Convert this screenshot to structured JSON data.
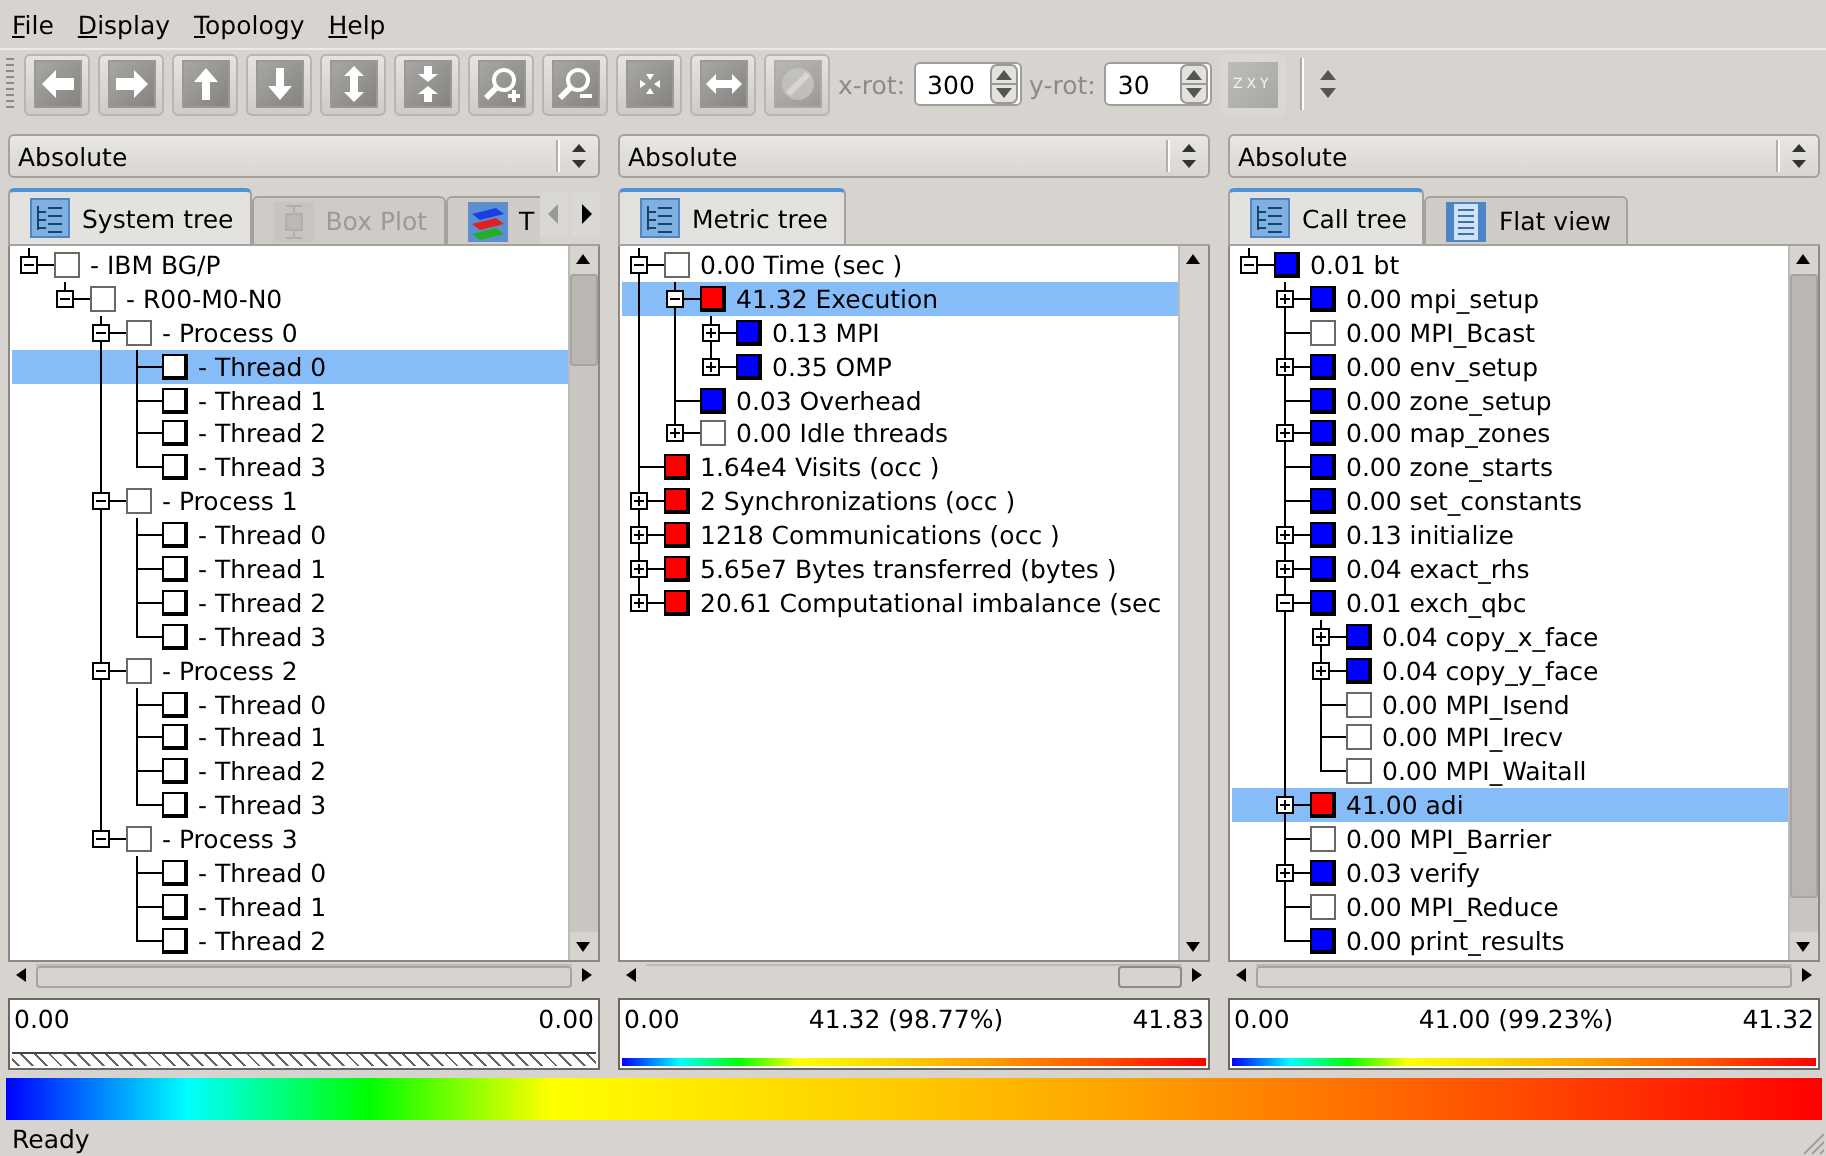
{
  "menu": [
    {
      "label": "File"
    },
    {
      "label": "Display"
    },
    {
      "label": "Topology"
    },
    {
      "label": "Help"
    }
  ],
  "toolbar": {
    "buttons": [
      {
        "kind": "left",
        "disabled": false
      },
      {
        "kind": "right",
        "disabled": false
      },
      {
        "kind": "up",
        "disabled": false
      },
      {
        "kind": "down",
        "disabled": false
      },
      {
        "kind": "updown",
        "disabled": false
      },
      {
        "kind": "converge",
        "disabled": false
      },
      {
        "kind": "zoomin",
        "disabled": false
      },
      {
        "kind": "zoomout",
        "disabled": false
      },
      {
        "kind": "center",
        "disabled": false
      },
      {
        "kind": "leftright",
        "disabled": false
      },
      {
        "kind": "sphere",
        "disabled": true
      }
    ],
    "x_rot": {
      "label": "x-rot:",
      "value": "300"
    },
    "y_rot": {
      "label": "y-rot:",
      "value": "30"
    },
    "axis_order": {
      "label": "ZXY",
      "disabled": true
    }
  },
  "panels": [
    {
      "mode": "Absolute",
      "tabs_scrollable": true,
      "tabs": [
        {
          "label": "System tree",
          "kind": "tree",
          "selected": true,
          "disabled": false
        },
        {
          "label": "Box Plot",
          "kind": "boxplot",
          "selected": false,
          "disabled": true
        },
        {
          "label": "T",
          "kind": "topology",
          "selected": false,
          "disabled": false
        }
      ],
      "tree": [
        {
          "label": "- IBM BG/P",
          "expanded": true,
          "selected": false,
          "children": [
            {
              "label": "- R00-M0-N0",
              "expanded": true,
              "selected": false,
              "children": [
                {
                  "label": "- Process 0",
                  "expanded": true,
                  "selected": false,
                  "children": [
                    {
                      "label": "- Thread 0",
                      "color": "#ffffff",
                      "selected": true
                    },
                    {
                      "label": "- Thread 1",
                      "color": "#ffffff",
                      "selected": false
                    },
                    {
                      "label": "- Thread 2",
                      "color": "#ffffff",
                      "selected": false
                    },
                    {
                      "label": "- Thread 3",
                      "color": "#ffffff",
                      "selected": false
                    }
                  ]
                },
                {
                  "label": "- Process 1",
                  "expanded": true,
                  "selected": false,
                  "children": [
                    {
                      "label": "- Thread 0",
                      "color": "#ffffff",
                      "selected": false
                    },
                    {
                      "label": "- Thread 1",
                      "color": "#ffffff",
                      "selected": false
                    },
                    {
                      "label": "- Thread 2",
                      "color": "#ffffff",
                      "selected": false
                    },
                    {
                      "label": "- Thread 3",
                      "color": "#ffffff",
                      "selected": false
                    }
                  ]
                },
                {
                  "label": "- Process 2",
                  "expanded": true,
                  "selected": false,
                  "children": [
                    {
                      "label": "- Thread 0",
                      "color": "#ffffff",
                      "selected": false
                    },
                    {
                      "label": "- Thread 1",
                      "color": "#ffffff",
                      "selected": false
                    },
                    {
                      "label": "- Thread 2",
                      "color": "#ffffff",
                      "selected": false
                    },
                    {
                      "label": "- Thread 3",
                      "color": "#ffffff",
                      "selected": false
                    }
                  ]
                },
                {
                  "label": "- Process 3",
                  "expanded": true,
                  "selected": false,
                  "children": [
                    {
                      "label": "- Thread 0",
                      "color": "#ffffff",
                      "selected": false
                    },
                    {
                      "label": "- Thread 1",
                      "color": "#ffffff",
                      "selected": false
                    },
                    {
                      "label": "- Thread 2",
                      "color": "#ffffff",
                      "selected": false
                    }
                  ]
                }
              ]
            }
          ]
        }
      ],
      "value_bar": {
        "kind": "hatched",
        "min": "0.00",
        "max": "0.00"
      }
    },
    {
      "mode": "Absolute",
      "tabs_scrollable": false,
      "tabs": [
        {
          "label": "Metric tree",
          "kind": "tree",
          "selected": true,
          "disabled": false
        }
      ],
      "tree": [
        {
          "label": "0.00 Time (sec )",
          "expanded": true,
          "selected": false,
          "children": [
            {
              "label": "41.32 Execution",
              "color": "#ff0000",
              "expanded": true,
              "selected": true,
              "children": [
                {
                  "label": "0.13 MPI",
                  "color": "#0000ff",
                  "expanded": false,
                  "selected": false
                },
                {
                  "label": "0.35 OMP",
                  "color": "#0000ff",
                  "expanded": false,
                  "selected": false
                }
              ]
            },
            {
              "label": "0.03 Overhead",
              "color": "#0000ff",
              "selected": false
            },
            {
              "label": "0.00 Idle threads",
              "expanded": false,
              "selected": false
            }
          ]
        },
        {
          "label": "1.64e4 Visits (occ )",
          "color": "#ff0000",
          "selected": false
        },
        {
          "label": "2 Synchronizations (occ )",
          "color": "#ff0000",
          "expanded": false,
          "selected": false
        },
        {
          "label": "1218 Communications (occ )",
          "color": "#ff0000",
          "expanded": false,
          "selected": false
        },
        {
          "label": "5.65e7 Bytes transferred (bytes )",
          "color": "#ff0000",
          "expanded": false,
          "selected": false
        },
        {
          "label": "20.61 Computational imbalance (sec",
          "color": "#ff0000",
          "expanded": false,
          "selected": false
        }
      ],
      "value_bar": {
        "kind": "gradient",
        "min": "0.00",
        "value": "41.32 (98.77%)",
        "max": "41.83"
      }
    },
    {
      "mode": "Absolute",
      "tabs_scrollable": false,
      "tabs": [
        {
          "label": "Call tree",
          "kind": "tree",
          "selected": true,
          "disabled": false
        },
        {
          "label": "Flat view",
          "kind": "flat",
          "selected": false,
          "disabled": false
        }
      ],
      "tree": [
        {
          "label": "0.01 bt",
          "color": "#0000ff",
          "expanded": true,
          "selected": false,
          "children": [
            {
              "label": "0.00 mpi_setup",
              "color": "#0000ff",
              "expanded": false,
              "selected": false
            },
            {
              "label": "0.00 MPI_Bcast",
              "selected": false
            },
            {
              "label": "0.00 env_setup",
              "color": "#0000ff",
              "expanded": false,
              "selected": false
            },
            {
              "label": "0.00 zone_setup",
              "color": "#0000ff",
              "selected": false
            },
            {
              "label": "0.00 map_zones",
              "color": "#0000ff",
              "expanded": false,
              "selected": false
            },
            {
              "label": "0.00 zone_starts",
              "color": "#0000ff",
              "selected": false
            },
            {
              "label": "0.00 set_constants",
              "color": "#0000ff",
              "selected": false
            },
            {
              "label": "0.13 initialize",
              "color": "#0000ff",
              "expanded": false,
              "selected": false
            },
            {
              "label": "0.04 exact_rhs",
              "color": "#0000ff",
              "expanded": false,
              "selected": false
            },
            {
              "label": "0.01 exch_qbc",
              "color": "#0000ff",
              "expanded": true,
              "selected": false,
              "children": [
                {
                  "label": "0.04 copy_x_face",
                  "color": "#0000ff",
                  "expanded": false,
                  "selected": false
                },
                {
                  "label": "0.04 copy_y_face",
                  "color": "#0000ff",
                  "expanded": false,
                  "selected": false
                },
                {
                  "label": "0.00 MPI_Isend",
                  "selected": false
                },
                {
                  "label": "0.00 MPI_Irecv",
                  "selected": false
                },
                {
                  "label": "0.00 MPI_Waitall",
                  "selected": false
                }
              ]
            },
            {
              "label": "41.00 adi",
              "color": "#ff0000",
              "expanded": false,
              "selected": true
            },
            {
              "label": "0.00 MPI_Barrier",
              "selected": false
            },
            {
              "label": "0.03 verify",
              "color": "#0000ff",
              "expanded": false,
              "selected": false
            },
            {
              "label": "0.00 MPI_Reduce",
              "selected": false
            },
            {
              "label": "0.00 print_results",
              "color": "#0000ff",
              "selected": false
            }
          ]
        }
      ],
      "value_bar": {
        "kind": "gradient",
        "min": "0.00",
        "value": "41.00 (99.23%)",
        "max": "41.32"
      }
    }
  ],
  "status_bar": {
    "text": "Ready"
  }
}
